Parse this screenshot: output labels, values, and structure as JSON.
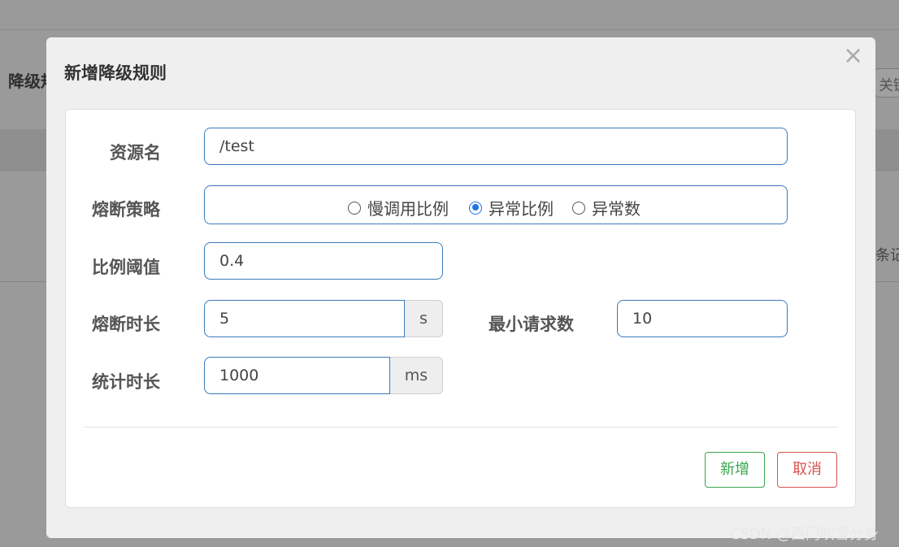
{
  "background": {
    "heading": "降级规",
    "search_placeholder": "关键",
    "records_text": "条记"
  },
  "modal": {
    "title": "新增降级规则",
    "close_label": "×",
    "fields": {
      "resource": {
        "label": "资源名",
        "value": "/test"
      },
      "strategy": {
        "label": "熔断策略",
        "options": [
          "慢调用比例",
          "异常比例",
          "异常数"
        ],
        "selected": "异常比例"
      },
      "ratio": {
        "label": "比例阈值",
        "value": "0.4"
      },
      "break_duration": {
        "label": "熔断时长",
        "value": "5",
        "unit": "s"
      },
      "min_requests": {
        "label": "最小请求数",
        "value": "10"
      },
      "stat_duration": {
        "label": "统计时长",
        "value": "1000",
        "unit": "ms"
      }
    },
    "buttons": {
      "add": "新增",
      "cancel": "取消"
    }
  },
  "watermark": "CSDN @西门吹雪分身",
  "colors": {
    "accent": "#3b7ab8",
    "add": "#3aa44e",
    "cancel": "#d9534f",
    "radio": "#1a73e8"
  }
}
